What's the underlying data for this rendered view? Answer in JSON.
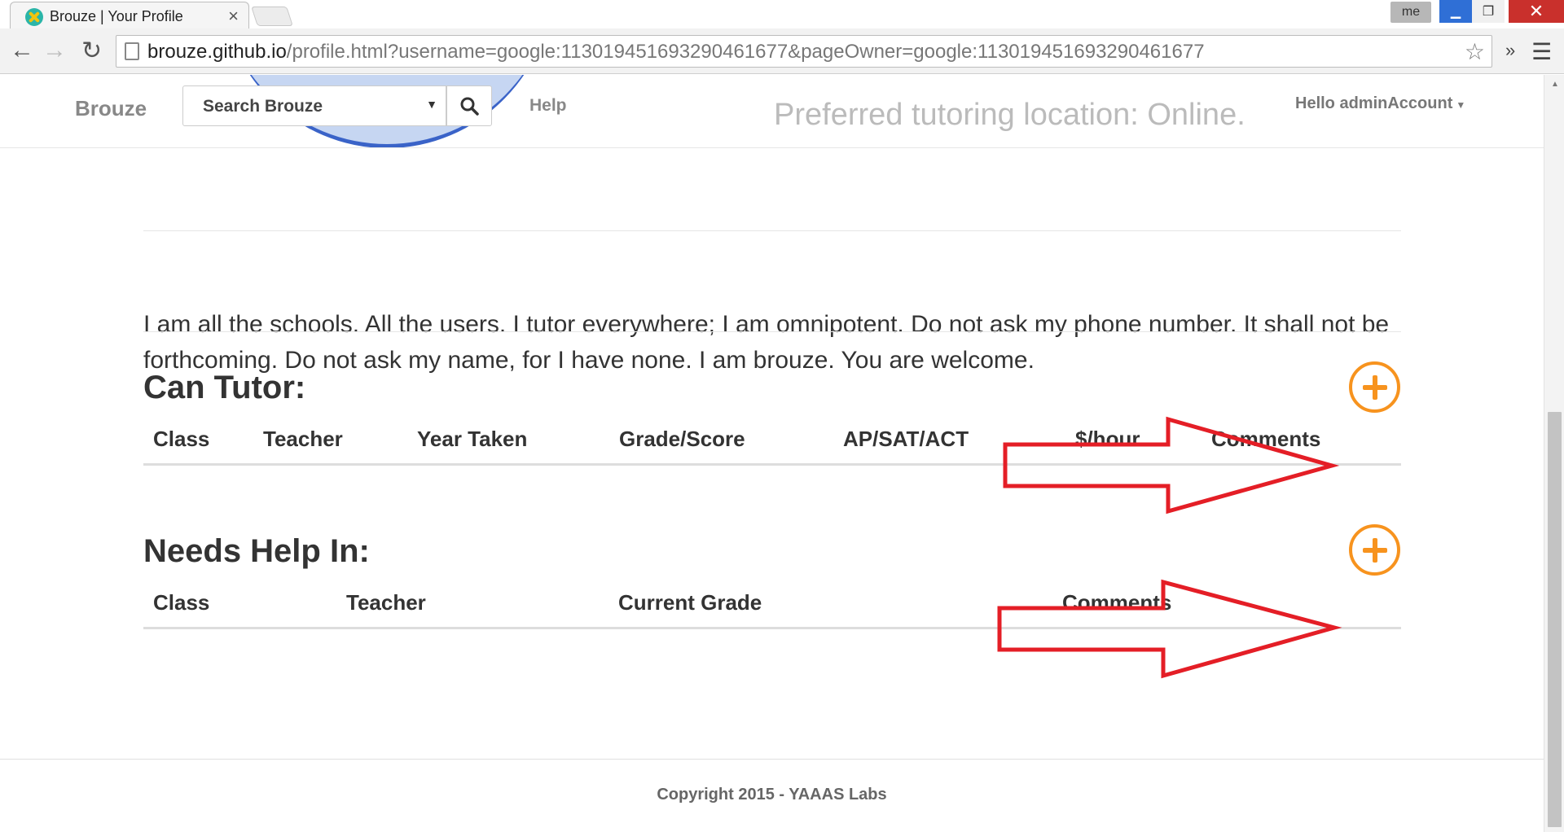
{
  "browser": {
    "tab_title": "Brouze | Your Profile",
    "tab_close": "×",
    "user_button": "me",
    "url_host": "brouze.github.io",
    "url_path": "/profile.html?username=google:113019451693290461677&pageOwner=google:113019451693290461677",
    "extensions_label": "»"
  },
  "navbar": {
    "brand": "Brouze",
    "search_label": "Search Brouze",
    "help": "Help",
    "preferred_location": "Preferred tutoring location: Online.",
    "hello": "Hello adminAccount"
  },
  "bio": "I am all the schools. All the users. I tutor everywhere; I am omnipotent. Do not ask my phone number. It shall not be forthcoming. Do not ask my name, for I have none. I am brouze. You are welcome.",
  "can_tutor": {
    "title": "Can Tutor:",
    "columns": [
      "Class",
      "Teacher",
      "Year Taken",
      "Grade/Score",
      "AP/SAT/ACT",
      "$/hour",
      "Comments"
    ]
  },
  "needs_help": {
    "title": "Needs Help In:",
    "columns": [
      "Class",
      "Teacher",
      "Current Grade",
      "Comments"
    ]
  },
  "footer": {
    "copyright": "Copyright 2015 - YAAAS Labs"
  },
  "colors": {
    "accent_orange": "#f7931e",
    "annotation_red": "#e41e26",
    "window_close": "#c9302c"
  }
}
